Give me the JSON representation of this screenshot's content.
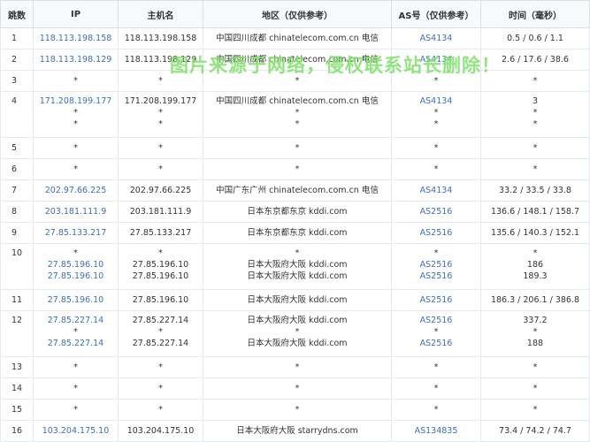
{
  "headers": {
    "hop": "跳数",
    "ip": "IP",
    "host": "主机名",
    "region": "地区（仅供参考）",
    "as": "AS号（仅供参考）",
    "time": "时间（毫秒）"
  },
  "rows": [
    {
      "hop": "1",
      "ip": [
        "118.113.198.158"
      ],
      "host": [
        "118.113.198.158"
      ],
      "region": [
        "中国四川成都 chinatelecom.com.cn 电信"
      ],
      "as": [
        "AS4134"
      ],
      "time": [
        "0.5 / 0.6 / 1.1"
      ]
    },
    {
      "hop": "2",
      "ip": [
        "118.113.198.129"
      ],
      "host": [
        "118.113.198.129"
      ],
      "region": [
        "中国四川成都 chinatelecom.com.cn 电信"
      ],
      "as": [
        "AS4134"
      ],
      "time": [
        "2.6 / 17.6 / 38.6"
      ]
    },
    {
      "hop": "3",
      "ip": [
        "*"
      ],
      "host": [
        "*"
      ],
      "region": [
        "*"
      ],
      "as": [
        "*"
      ],
      "time": [
        "*"
      ]
    },
    {
      "hop": "4",
      "ip": [
        "171.208.199.177",
        "*",
        "*"
      ],
      "host": [
        "171.208.199.177",
        "*",
        "*"
      ],
      "region": [
        "中国四川成都 chinatelecom.com.cn 电信",
        "*",
        "*"
      ],
      "as": [
        "AS4134",
        "*",
        "*"
      ],
      "time": [
        "3",
        "*",
        "*"
      ]
    },
    {
      "hop": "5",
      "ip": [
        "*"
      ],
      "host": [
        "*"
      ],
      "region": [
        "*"
      ],
      "as": [
        "*"
      ],
      "time": [
        "*"
      ]
    },
    {
      "hop": "6",
      "ip": [
        "*"
      ],
      "host": [
        "*"
      ],
      "region": [
        "*"
      ],
      "as": [
        "*"
      ],
      "time": [
        "*"
      ]
    },
    {
      "hop": "7",
      "ip": [
        "202.97.66.225"
      ],
      "host": [
        "202.97.66.225"
      ],
      "region": [
        "中国广东广州 chinatelecom.com.cn 电信"
      ],
      "as": [
        "AS4134"
      ],
      "time": [
        "33.2 / 33.5 / 33.8"
      ]
    },
    {
      "hop": "8",
      "ip": [
        "203.181.111.9"
      ],
      "host": [
        "203.181.111.9"
      ],
      "region": [
        "日本东京都东京 kddi.com"
      ],
      "as": [
        "AS2516"
      ],
      "time": [
        "136.6 / 148.1 / 158.7"
      ]
    },
    {
      "hop": "9",
      "ip": [
        "27.85.133.217"
      ],
      "host": [
        "27.85.133.217"
      ],
      "region": [
        "日本东京都东京 kddi.com"
      ],
      "as": [
        "AS2516"
      ],
      "time": [
        "135.6 / 140.3 / 152.1"
      ]
    },
    {
      "hop": "10",
      "ip": [
        "*",
        "27.85.196.10",
        "27.85.196.10"
      ],
      "host": [
        "*",
        "27.85.196.10",
        "27.85.196.10"
      ],
      "region": [
        "*",
        "日本大阪府大阪 kddi.com",
        "日本大阪府大阪 kddi.com"
      ],
      "as": [
        "*",
        "AS2516",
        "AS2516"
      ],
      "time": [
        "*",
        "186",
        "189.3"
      ]
    },
    {
      "hop": "11",
      "ip": [
        "27.85.196.10"
      ],
      "host": [
        "27.85.196.10"
      ],
      "region": [
        "日本大阪府大阪 kddi.com"
      ],
      "as": [
        "AS2516"
      ],
      "time": [
        "186.3 / 206.1 / 386.8"
      ]
    },
    {
      "hop": "12",
      "ip": [
        "27.85.227.14",
        "*",
        "27.85.227.14"
      ],
      "host": [
        "27.85.227.14",
        "*",
        "27.85.227.14"
      ],
      "region": [
        "日本大阪府大阪 kddi.com",
        "*",
        "日本大阪府大阪 kddi.com"
      ],
      "as": [
        "AS2516",
        "*",
        "AS2516"
      ],
      "time": [
        "337.2",
        "*",
        "188"
      ]
    },
    {
      "hop": "13",
      "ip": [
        "*"
      ],
      "host": [
        "*"
      ],
      "region": [
        "*"
      ],
      "as": [
        "*"
      ],
      "time": [
        "*"
      ]
    },
    {
      "hop": "14",
      "ip": [
        "*"
      ],
      "host": [
        "*"
      ],
      "region": [
        "*"
      ],
      "as": [
        "*"
      ],
      "time": [
        "*"
      ]
    },
    {
      "hop": "15",
      "ip": [
        "*"
      ],
      "host": [
        "*"
      ],
      "region": [
        "*"
      ],
      "as": [
        "*"
      ],
      "time": [
        "*"
      ]
    },
    {
      "hop": "16",
      "ip": [
        "103.204.175.10"
      ],
      "host": [
        "103.204.175.10"
      ],
      "region": [
        "日本大阪府大阪 starrydns.com"
      ],
      "as": [
        "AS134835"
      ],
      "time": [
        "73.4 / 74.2 / 74.7"
      ]
    }
  ],
  "watermark": "图片来源于网络，侵权联系站长删除！",
  "colors": {
    "link": "#3d6fb6",
    "text": "#333333",
    "header_bg": "#f7f9fb",
    "border": "#e6e9ef",
    "watermark": "#7fe06a"
  }
}
